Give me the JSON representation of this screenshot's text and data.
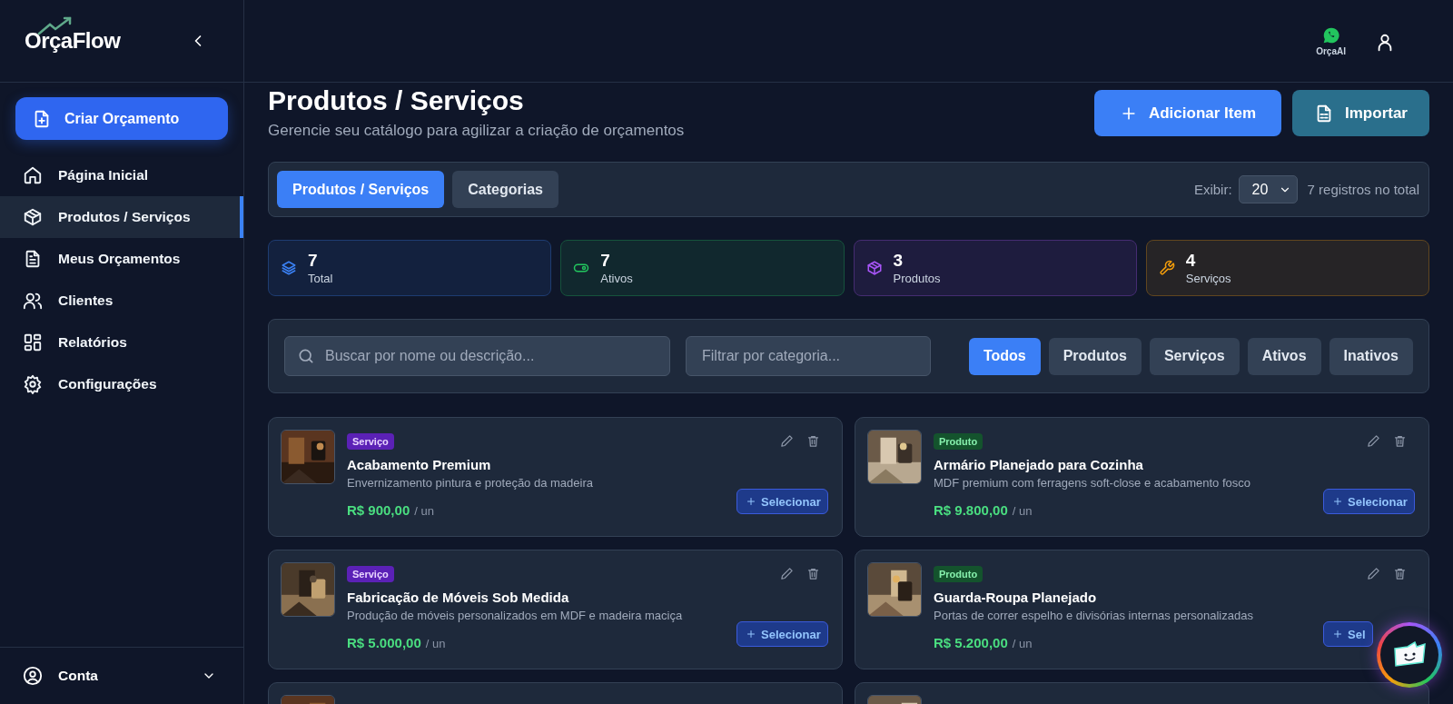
{
  "sidebar": {
    "brand": "OrçaFlow",
    "create_button": "Criar Orçamento",
    "items": [
      {
        "label": "Página Inicial",
        "selected": false
      },
      {
        "label": "Produtos / Serviços",
        "selected": true
      },
      {
        "label": "Meus Orçamentos",
        "selected": false
      },
      {
        "label": "Clientes",
        "selected": false
      },
      {
        "label": "Relatórios",
        "selected": false
      },
      {
        "label": "Configurações",
        "selected": false
      }
    ],
    "account": "Conta"
  },
  "header": {
    "assistant_label": "OrçaAI"
  },
  "page": {
    "title": "Produtos / Serviços",
    "subtitle": "Gerencie seu catálogo para agilizar a criação de orçamentos",
    "add_button": "Adicionar Item",
    "import_button": "Importar"
  },
  "tabs": [
    {
      "label": "Produtos / Serviços",
      "selected": true
    },
    {
      "label": "Categorias",
      "selected": false
    }
  ],
  "page_size": {
    "label": "Exibir:",
    "value": "20",
    "total": "7 registros no total"
  },
  "stats": [
    {
      "value": "7",
      "label": "Total",
      "color": "#3b82f6"
    },
    {
      "value": "7",
      "label": "Ativos",
      "color": "#22c55e"
    },
    {
      "value": "3",
      "label": "Produtos",
      "color": "#a855f7"
    },
    {
      "value": "4",
      "label": "Serviços",
      "color": "#f59e0b"
    }
  ],
  "filters": {
    "search_placeholder": "Buscar por nome ou descrição...",
    "category_placeholder": "Filtrar por categoria...",
    "chips": [
      {
        "label": "Todos",
        "selected": true
      },
      {
        "label": "Produtos",
        "selected": false
      },
      {
        "label": "Serviços",
        "selected": false
      },
      {
        "label": "Ativos",
        "selected": false
      },
      {
        "label": "Inativos",
        "selected": false
      }
    ]
  },
  "items": [
    {
      "kind": "service",
      "badge": "Serviço",
      "name": "Acabamento Premium",
      "description": "Envernizamento pintura e proteção da madeira",
      "price": "R$ 900,00",
      "unit": "/ un",
      "select_button": "Selecionar"
    },
    {
      "kind": "product",
      "badge": "Produto",
      "name": "Armário Planejado para Cozinha",
      "description": "MDF premium com ferragens soft-close e acabamento fosco",
      "price": "R$ 9.800,00",
      "unit": "/ un",
      "select_button": "Selecionar"
    },
    {
      "kind": "service",
      "badge": "Serviço",
      "name": "Fabricação de Móveis Sob Medida",
      "description": "Produção de móveis personalizados em MDF e madeira maciça",
      "price": "R$ 5.000,00",
      "unit": "/ un",
      "select_button": "Selecionar"
    },
    {
      "kind": "product",
      "badge": "Produto",
      "name": "Guarda-Roupa Planejado",
      "description": "Portas de correr espelho e divisórias internas personalizadas",
      "price": "R$ 5.200,00",
      "unit": "/ un",
      "select_button": "Sel"
    },
    {
      "kind": "cut_off"
    },
    {
      "kind": "cut_off"
    }
  ]
}
